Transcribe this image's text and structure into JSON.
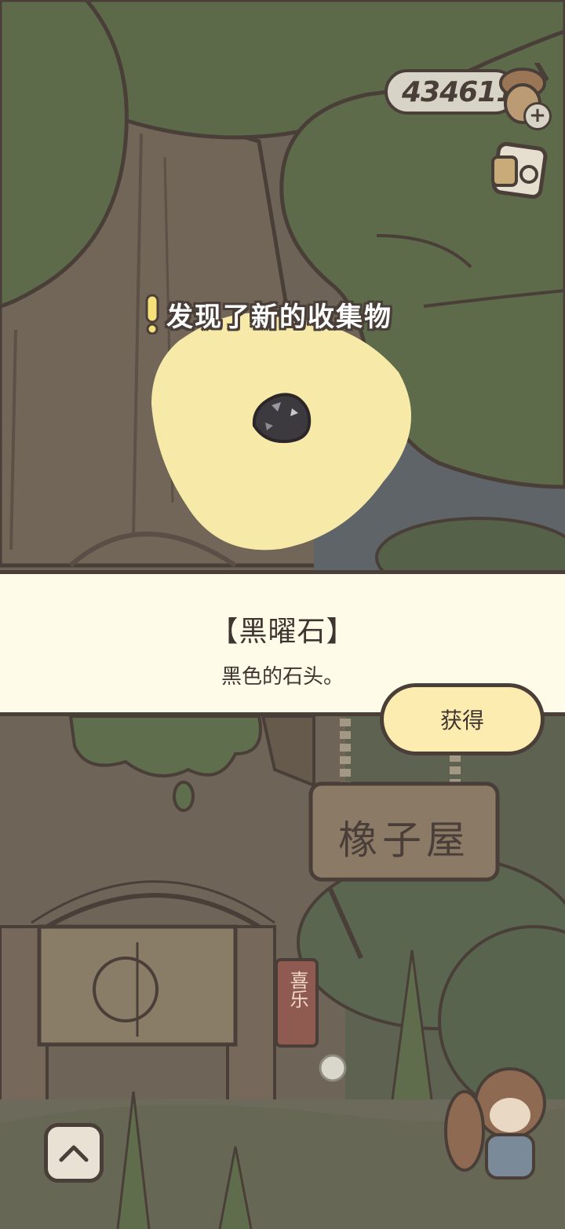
{
  "hud": {
    "acorn_count": "434611",
    "plus_label": "+"
  },
  "discovery": {
    "banner_text": "发现了新的收集物"
  },
  "item": {
    "name": "【黑曜石】",
    "description": "黑色的石头。"
  },
  "actions": {
    "obtain_label": "获得"
  },
  "scene": {
    "shop_sign_text": "橡子屋",
    "scroll_text": "喜乐"
  },
  "icons": {
    "acorn": "acorn-icon",
    "ticket": "ticket-icon",
    "up": "chevron-up-icon",
    "exclaim": "exclamation-icon",
    "obsidian": "obsidian-stone-icon"
  },
  "colors": {
    "outline": "#4a3f38",
    "panel_bg": "#fefbe8",
    "button_bg": "#fdecb0",
    "glow": "#f7eaa8",
    "foliage": "#5a6a48",
    "trunk": "#75685c"
  }
}
